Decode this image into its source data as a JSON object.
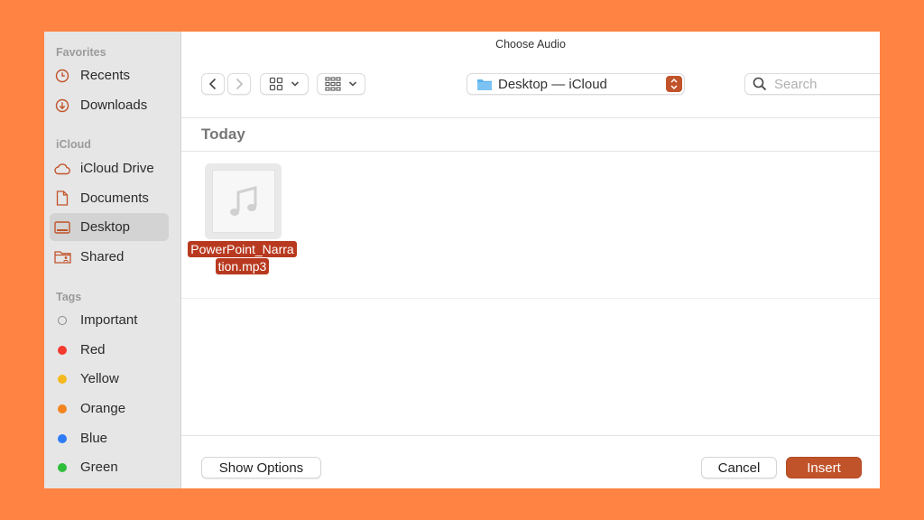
{
  "dialog": {
    "title": "Choose Audio"
  },
  "sidebar": {
    "favorites_heading": "Favorites",
    "favorites": [
      {
        "label": "Recents",
        "icon": "clock-icon"
      },
      {
        "label": "Downloads",
        "icon": "download-icon"
      }
    ],
    "icloud_heading": "iCloud",
    "icloud": [
      {
        "label": "iCloud Drive",
        "icon": "cloud-icon"
      },
      {
        "label": "Documents",
        "icon": "document-icon"
      },
      {
        "label": "Desktop",
        "icon": "desktop-icon",
        "selected": true
      },
      {
        "label": "Shared",
        "icon": "shared-folder-icon"
      }
    ],
    "tags_heading": "Tags",
    "tags": [
      {
        "label": "Important",
        "color": ""
      },
      {
        "label": "Red",
        "color": "#f23a2f"
      },
      {
        "label": "Yellow",
        "color": "#f5b91e"
      },
      {
        "label": "Orange",
        "color": "#f3841f"
      },
      {
        "label": "Blue",
        "color": "#2d7cf6"
      },
      {
        "label": "Green",
        "color": "#2fbd3c"
      }
    ]
  },
  "toolbar": {
    "location": "Desktop — iCloud",
    "search_placeholder": "Search"
  },
  "content": {
    "group_header": "Today",
    "file": {
      "name": "PowerPoint_Narration.mp3",
      "name_line1": "PowerPoint_Narra",
      "name_line2": "tion.mp3"
    }
  },
  "footer": {
    "show_options": "Show Options",
    "cancel": "Cancel",
    "insert": "Insert"
  },
  "colors": {
    "background": "#ff8343",
    "accent": "#c1532a",
    "sidebar_icon": "#c1532a",
    "selection": "#b8391f"
  }
}
